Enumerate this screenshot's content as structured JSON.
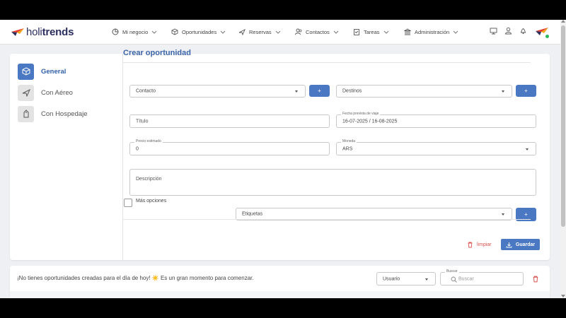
{
  "brand": {
    "name_light": "holi",
    "name_bold": "trends"
  },
  "nav": {
    "items": [
      {
        "label": "Mi negocio",
        "icon": "pie-chart-icon"
      },
      {
        "label": "Oportunidades",
        "icon": "cube-icon"
      },
      {
        "label": "Reservas",
        "icon": "plane-icon"
      },
      {
        "label": "Contactos",
        "icon": "users-icon"
      },
      {
        "label": "Tareas",
        "icon": "clipboard-icon"
      },
      {
        "label": "Administración",
        "icon": "bank-icon"
      }
    ]
  },
  "sidebar": {
    "items": [
      {
        "label": "General",
        "icon": "cube-icon",
        "active": true
      },
      {
        "label": "Con Aéreo",
        "icon": "plane-icon",
        "active": false
      },
      {
        "label": "Con Hospedaje",
        "icon": "luggage-tag-icon",
        "active": false
      }
    ]
  },
  "form": {
    "title": "Crear oportunidad",
    "contacto": "Contacto",
    "destinos": "Destinos",
    "titulo": "Título",
    "fecha_label": "Fecha prevista de viaje",
    "fecha_value": "16-07-2025 / 16-08-2025",
    "precio_label": "Precio estimado",
    "precio_value": "0",
    "moneda_label": "Moneda",
    "moneda_value": "ARS",
    "descripcion": "Descripción",
    "mas_opciones": "Más opciones",
    "etiquetas": "Etiquetas",
    "plus": "+",
    "limpiar": "limpiar",
    "guardar": "Guardar"
  },
  "bottom": {
    "message": "¡No tienes oportunidades creadas para el día de hoy! ☀️ Es un gran momento para comenzar.",
    "usuario": "Usuario",
    "buscar_label": "Buscar",
    "buscar_placeholder": "Buscar"
  },
  "colors": {
    "accent": "#4a78c2",
    "title": "#3b64a8",
    "danger": "#d9534f"
  }
}
